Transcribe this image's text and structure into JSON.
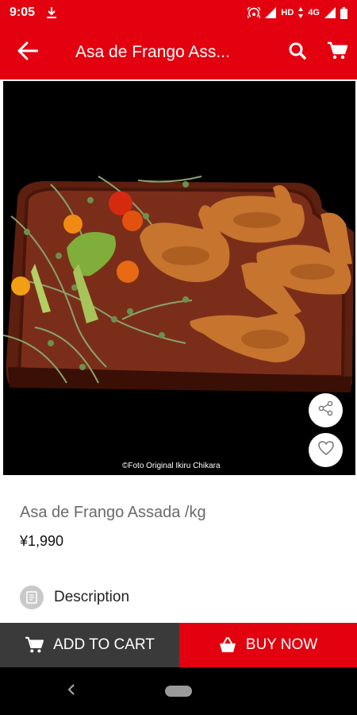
{
  "status_bar": {
    "time": "9:05",
    "network": "HD",
    "network_type": "4G"
  },
  "app_bar": {
    "title": "Asa de Frango Ass..."
  },
  "product": {
    "image_credit": "©Foto Original Ikiru Chikara",
    "name": "Asa de Frango Assada /kg",
    "price": "¥1,990",
    "description_label": "Description"
  },
  "actions": {
    "add_to_cart": "ADD TO CART",
    "buy_now": "BUY NOW"
  },
  "colors": {
    "brand_red": "#e3000f",
    "cart_button": "#3a3a3a"
  },
  "icons": [
    "download-icon",
    "hotspot-icon",
    "signal-icon",
    "battery-icon",
    "back-arrow-icon",
    "search-icon",
    "cart-icon",
    "share-icon",
    "heart-icon",
    "document-icon",
    "basket-icon",
    "nav-back-icon"
  ]
}
